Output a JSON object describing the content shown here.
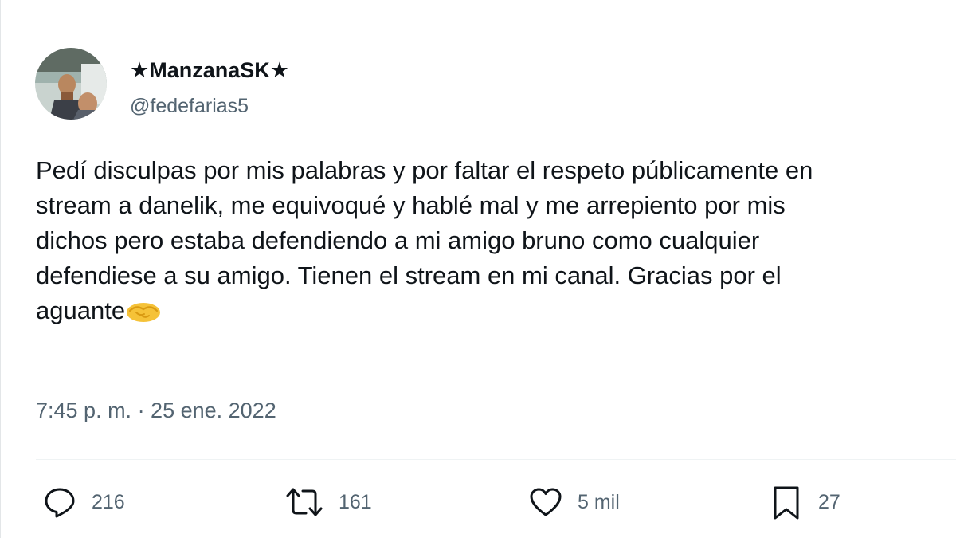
{
  "author": {
    "display_name": "★ManzanaSK★",
    "handle": "@fedefarias5",
    "avatar_icon": "profile-photo"
  },
  "tweet": {
    "lines": [
      "Pedí disculpas por mis palabras y por faltar el respeto públicamente en",
      "stream a danelik, me equivoqué y hablé mal y me arrepiento por mis",
      "dichos pero estaba defendiendo a mi amigo bruno como cualquier",
      "defendiese a su amigo. Tienen el stream en mi canal. Gracias por el",
      "aguante"
    ],
    "emoji": "handshake-emoji",
    "timestamp": "7:45 p. m. · 25 ene. 2022"
  },
  "actions": {
    "reply": {
      "icon": "reply-icon",
      "count": "216"
    },
    "retweet": {
      "icon": "retweet-icon",
      "count": "161"
    },
    "like": {
      "icon": "heart-icon",
      "count": "5 mil"
    },
    "bookmark": {
      "icon": "bookmark-icon",
      "count": "27"
    }
  },
  "colors": {
    "text": "#0f1419",
    "secondary": "#536471",
    "divider": "#eff3f4",
    "emoji": "#f5c238"
  }
}
